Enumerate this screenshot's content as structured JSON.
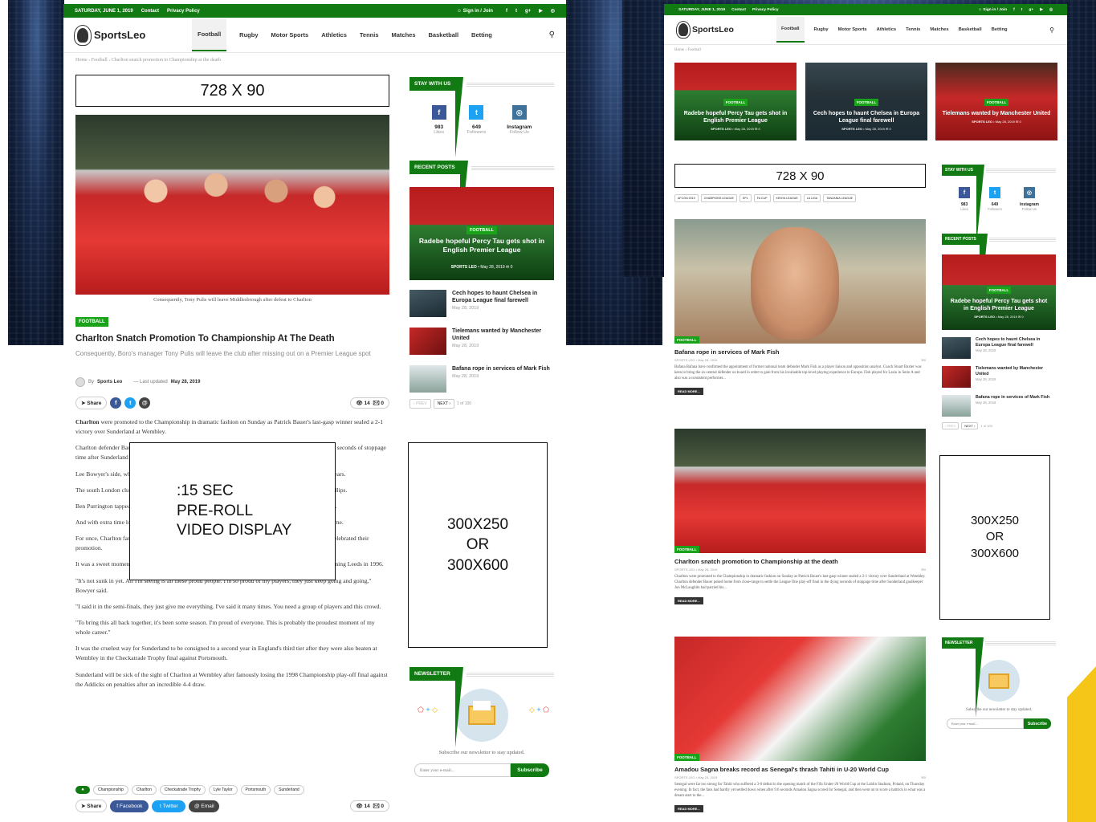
{
  "topbar": {
    "date": "SATURDAY, JUNE 1, 2019",
    "links": [
      "Contact",
      "Privacy Policy"
    ],
    "signin": "Sign in / Join",
    "social_icons": [
      "f",
      "t",
      "g+",
      "▶",
      "◎"
    ]
  },
  "brand": {
    "logo_text": "SportsLeo"
  },
  "nav": {
    "items": [
      "Football",
      "Rugby",
      "Motor Sports",
      "Athletics",
      "Tennis",
      "Matches",
      "Basketball",
      "Betting"
    ],
    "active": "Football"
  },
  "left": {
    "breadcrumb": [
      "Home",
      "Football",
      "Charlton snatch promotion to Championship at the death"
    ],
    "ad_leader": "728 X 90",
    "image_caption": "Consequently, Tony Pulis will leave Middlesbrough after defeat to Charlton",
    "category": "FOOTBALL",
    "title": "Charlton Snatch Promotion To Championship At The Death",
    "subtitle": "Consequently, Boro's manager Tony Pulis will leave the club after missing out on a Premier League spot",
    "meta": {
      "by": "By",
      "author": "Sports Leo",
      "updated_label": "Last updated",
      "updated": "May 28, 2019"
    },
    "share_label": "Share",
    "views": "14",
    "comments": "0",
    "paragraphs": [
      {
        "bold": "Charlton",
        "text": " were promoted to the Championship in dramatic fashion on Sunday as Patrick Bauer's last-gasp winner sealed a 2-1 victory over Sunderland at Wembley."
      },
      {
        "bold": "",
        "text": "Charlton defender Bauer poked home from close-range to settle the League One play-off final in the dying seconds of stoppage time after Sunderland goalkeeper Jon McLaughlin had parried his header."
      },
      {
        "bold": "",
        "text": "Lee Bowyer's side, who finished third in the table, will return to the second tier for the first time in three years."
      },
      {
        "bold": "",
        "text": "The south London club went behind when Naby Sarr's backpass eluded dozing Charlton keeper Dillon Phillips."
      },
      {
        "bold": "",
        "text": "Ben Purrington tapped in the equaliser from Joe Aribo's cross, featuring a pin-point cross from Lyle Taylor."
      },
      {
        "bold": "",
        "text": "And with extra time looming, the Addicks' season-long push ended with captain Bauer guiding his side home."
      },
      {
        "bold": "",
        "text": "For once, Charlton fans were able to set aside their protests against the club's hated ownership as 36,000 celebrated their promotion."
      },
      {
        "bold": "",
        "text": "It was a sweet moment for former Charlton midfielder Bowyer, who began his career at the club before joining Leeds in 1996."
      },
      {
        "bold": "",
        "text": "\"It's not sunk in yet. All I'm seeing is all these proud people. I'm so proud of my players, they just keep going and going,\" Bowyer said."
      },
      {
        "bold": "",
        "text": "\"I said it in the semi-finals, they just give me everything. I've said it many times. You need a group of players and this crowd."
      },
      {
        "bold": "",
        "text": "\"To bring this all back together, it's been some season. I'm proud of everyone. This is probably the proudest moment of my whole career.\""
      },
      {
        "bold": "",
        "text": "It was the cruelest way for Sunderland to be consigned to a second year in England's third tier after they were also beaten at Wembley in the Checkatrade Trophy final against Portsmouth."
      },
      {
        "bold": "",
        "text": "Sunderland will be sick of the sight of Charlton at Wembley after famously losing the 1998 Championship play-off final against the Addicks on penalties after an incredible 4-4 draw."
      }
    ],
    "video_ad": [
      ":15 SEC",
      "PRE-ROLL",
      "VIDEO DISPLAY"
    ],
    "tags": [
      "Championship",
      "Charlton",
      "Checkatrade Trophy",
      "Lyle Taylor",
      "Portsmouth",
      "Sunderland"
    ],
    "share_buttons": [
      "Facebook",
      "Twitter",
      "Email"
    ]
  },
  "sidebar": {
    "stay_title": "STAY WITH US",
    "social": [
      {
        "icon": "f",
        "count": "983",
        "label": "Likes",
        "color": "#3b5998"
      },
      {
        "icon": "t",
        "count": "649",
        "label": "Followers",
        "color": "#1da1f2"
      },
      {
        "icon": "◎",
        "count": "Instagram",
        "label": "Follow Us",
        "color": "#3f729b"
      }
    ],
    "recent_title": "RECENT POSTS",
    "featured": {
      "tag": "FOOTBALL",
      "title": "Radebe hopeful Percy Tau gets shot in English Premier League",
      "author": "SPORTS LEO",
      "date": "May 28, 2019",
      "comments": "0"
    },
    "posts": [
      {
        "title": "Cech hopes to haunt Chelsea in Europa League final farewell",
        "date": "May 28, 2019"
      },
      {
        "title": "Tielemans wanted by Manchester United",
        "date": "May 28, 2019"
      },
      {
        "title": "Bafana rope in services of Mark Fish",
        "date": "May 28, 2019"
      }
    ],
    "pager": {
      "prev": "PREV",
      "next": "NEXT",
      "info": "1 of 100"
    },
    "ad_box": [
      "300X250",
      "OR",
      "300X600"
    ],
    "newsletter_title": "NEWSLETTER",
    "newsletter_text": "Subscribe our newsletter to stay updated.",
    "email_placeholder": "Enter your e-mail...",
    "subscribe": "Subscribe"
  },
  "right": {
    "breadcrumb": [
      "Home",
      "Football"
    ],
    "top_cards": [
      {
        "tag": "FOOTBALL",
        "title": "Radebe hopeful Percy Tau gets shot in English Premier League",
        "author": "SPORTS LEO",
        "date": "May 28, 2019",
        "comments": "0"
      },
      {
        "tag": "FOOTBALL",
        "title": "Cech hopes to haunt Chelsea in Europa League final farewell",
        "author": "SPORTS LEO",
        "date": "May 28, 2019",
        "comments": "0"
      },
      {
        "tag": "FOOTBALL",
        "title": "Tielemans wanted by Manchester United",
        "author": "SPORTS LEO",
        "date": "May 28, 2019",
        "comments": "0"
      }
    ],
    "ad_leader": "728 X 90",
    "league_tags": [
      "AFCON 2019",
      "CHAMPIONS LEAGUE",
      "EPL",
      "FA CUP",
      "KENYA LEAGUE",
      "LA LIGA",
      "TANZANIA LEAGUE"
    ],
    "articles": [
      {
        "tag": "FOOTBALL",
        "title": "Bafana rope in services of Mark Fish",
        "author": "SPORTS LEO",
        "date": "May 28, 2019",
        "comments": "0",
        "excerpt": "Bafana Bafana have confirmed the appointment of former national team defender Mark Fish as a player liaison and opposition analyst. Coach Stuart Baxter was keen to bring the ex-central defender on board in order to gain from his invaluable top-level playing experience in Europe. Fish played for Lazio in Serie A and also was a consistent performer...",
        "more": "READ MORE..."
      },
      {
        "tag": "FOOTBALL",
        "title": "Charlton snatch promotion to Championship at the death",
        "author": "SPORTS LEO",
        "date": "May 28, 2019",
        "comments": "0",
        "excerpt": "Charlton were promoted to the Championship in dramatic fashion on Sunday as Patrick Bauer's last-gasp winner sealed a 2-1 victory over Sunderland at Wembley. Charlton defender Bauer poked home from close-range to settle the League One play-off final in the dying seconds of stoppage time after Sunderland goalkeeper Jon McLaughlin had parried his...",
        "more": "READ MORE..."
      },
      {
        "tag": "FOOTBALL",
        "title": "Amadou Sagna breaks record as Senegal's thrash Tahiti in U-20 World Cup",
        "author": "SPORTS LEO",
        "date": "May 23, 2019",
        "comments": "0",
        "excerpt": "Senegal were far too strong for Tahiti who suffered a 3-0 defeat in the opening match of the Fifa Under-20 World Cup at the Lublin Stadium, Poland, on Thursday evening. In fact, the fans had hardly yet settled down when after 9.6 seconds Amadou Sagna scored for Senegal, and then went on to score a hattrick in what was a dream start to the...",
        "more": "READ MORE..."
      }
    ],
    "sidebar": {
      "stay_title": "STAY WITH US",
      "social": [
        {
          "icon": "f",
          "count": "983",
          "label": "Likes",
          "color": "#3b5998"
        },
        {
          "icon": "t",
          "count": "649",
          "label": "Followers",
          "color": "#1da1f2"
        },
        {
          "icon": "◎",
          "count": "Instagram",
          "label": "Follow Us",
          "color": "#3f729b"
        }
      ],
      "recent_title": "RECENT POSTS",
      "featured": {
        "tag": "FOOTBALL",
        "title": "Radebe hopeful Percy Tau gets shot in English Premier League",
        "author": "SPORTS LEO",
        "date": "May 28, 2019",
        "comments": "0"
      },
      "posts": [
        {
          "title": "Cech hopes to haunt Chelsea in Europa League final farewell",
          "date": "May 28, 2019"
        },
        {
          "title": "Tielemans wanted by Manchester United",
          "date": "May 28, 2019"
        },
        {
          "title": "Bafana rope in services of Mark Fish",
          "date": "May 28, 2019"
        }
      ],
      "pager": {
        "prev": "PREV",
        "next": "NEXT",
        "info": "1 of 100"
      },
      "ad_box": [
        "300X250",
        "OR",
        "300X600"
      ],
      "newsletter_title": "NEWSLETTER",
      "newsletter_text": "Subscribe our newsletter to stay updated.",
      "email_placeholder": "Enter your e-mail...",
      "subscribe": "Subscribe"
    }
  },
  "colors": {
    "brand_green": "#127a12",
    "tag_green": "#1aa31a",
    "accent_yellow": "#f5c518"
  }
}
